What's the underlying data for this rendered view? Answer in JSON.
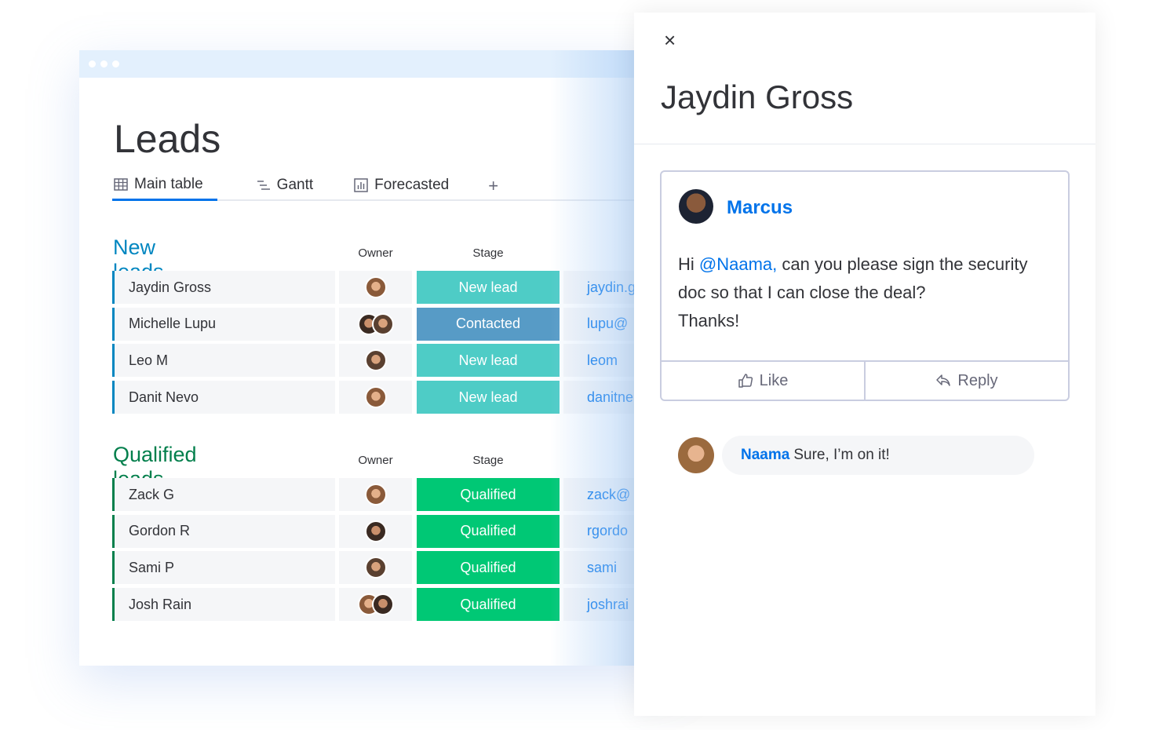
{
  "board": {
    "title": "Leads",
    "tabs": [
      {
        "label": "Main table",
        "icon": "table-icon",
        "active": true
      },
      {
        "label": "Gantt",
        "icon": "gantt-icon"
      },
      {
        "label": "Forecasted",
        "icon": "chart-icon"
      }
    ],
    "add_tab": "+",
    "groups": [
      {
        "title": "New leads",
        "color": "#0086c0",
        "owner_header": "Owner",
        "stage_header": "Stage",
        "rows": [
          {
            "name": "Jaydin Gross",
            "owners": 1,
            "stage": "New lead",
            "stage_color": "#4eccc6",
            "email": "jaydin.g"
          },
          {
            "name": "Michelle Lupu",
            "owners": 2,
            "stage": "Contacted",
            "stage_color": "#579bc6",
            "email": "lupu@"
          },
          {
            "name": "Leo M",
            "owners": 1,
            "stage": "New lead",
            "stage_color": "#4eccc6",
            "email": "leom"
          },
          {
            "name": "Danit Nevo",
            "owners": 1,
            "stage": "New lead",
            "stage_color": "#4eccc6",
            "email": "danitne"
          }
        ]
      },
      {
        "title": "Qualified leads",
        "color": "#037f4c",
        "owner_header": "Owner",
        "stage_header": "Stage",
        "rows": [
          {
            "name": "Zack G",
            "owners": 1,
            "stage": "Qualified",
            "stage_color": "#00c875",
            "email": "zack@"
          },
          {
            "name": "Gordon R",
            "owners": 1,
            "stage": "Qualified",
            "stage_color": "#00c875",
            "email": "rgordo"
          },
          {
            "name": "Sami P",
            "owners": 1,
            "stage": "Qualified",
            "stage_color": "#00c875",
            "email": "sami"
          },
          {
            "name": "Josh Rain",
            "owners": 2,
            "stage": "Qualified",
            "stage_color": "#00c875",
            "email": "joshrai"
          }
        ]
      }
    ]
  },
  "panel": {
    "title": "Jaydin Gross",
    "close": "×",
    "post": {
      "author": "Marcus",
      "greeting": "Hi ",
      "mention": "@Naama,",
      "text": " can you please sign the security doc so that I can close the deal?",
      "signoff": "Thanks!",
      "like": "Like",
      "reply": "Reply"
    },
    "reply": {
      "author": "Naama",
      "text": "Sure, I’m on it!"
    }
  }
}
